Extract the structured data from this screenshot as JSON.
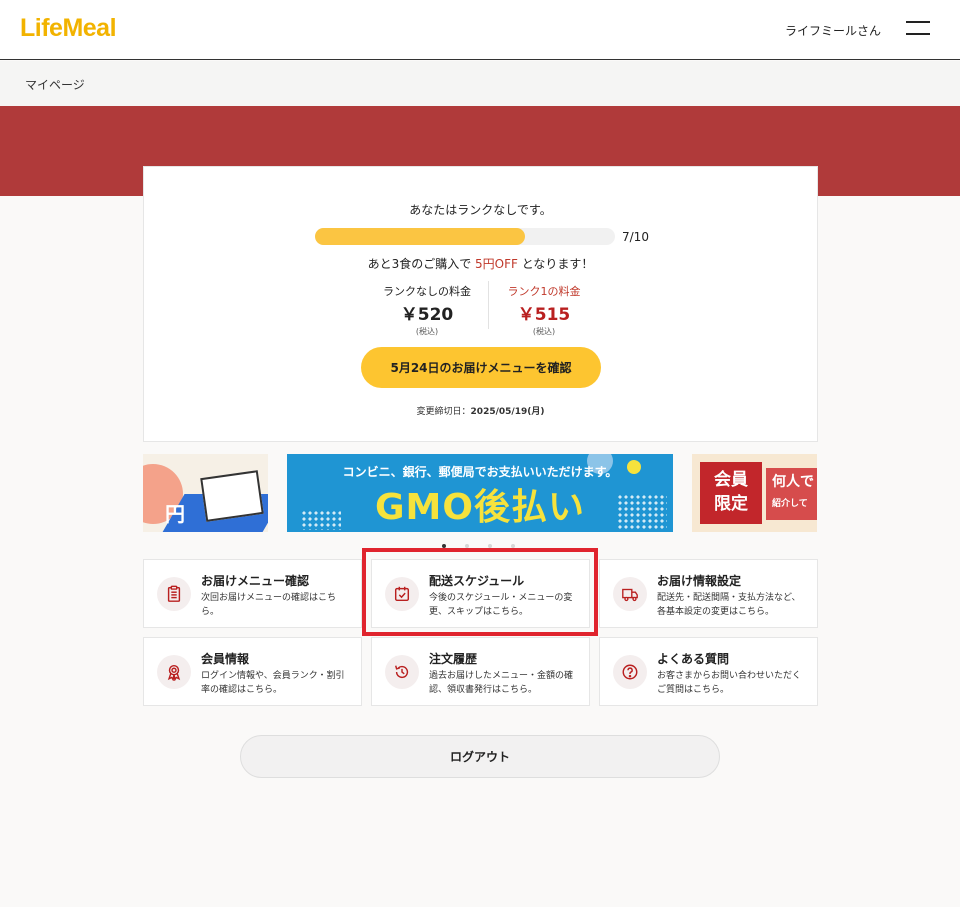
{
  "header": {
    "logo": "LifeMeal",
    "user_name": "ライフミールさん",
    "menu_icon": "hamburger-menu-icon"
  },
  "breadcrumb": {
    "current": "マイページ"
  },
  "colors": {
    "brand_yellow": "#f2b300",
    "accent_red": "#b03a3a",
    "button_yellow": "#fdc530",
    "progress_fill": "#fbc542",
    "highlight_red": "#e0242e"
  },
  "rank": {
    "status": "あなたはランクなしです。",
    "progress_current": 7,
    "progress_total": 10,
    "progress_label": "7/10",
    "message_prefix": "あと3食のご購入で",
    "message_discount": "5円OFF",
    "message_suffix": "となります！",
    "current_price_label": "ランクなしの料金",
    "current_price": "￥520",
    "next_price_label": "ランク1の料金",
    "next_price": "￥515",
    "tax_note": "(税込)",
    "confirm_button": "5月24日のお届けメニューを確認",
    "deadline_label": "変更締切日：",
    "deadline_date": "2025/05/19(月)"
  },
  "banners": {
    "main_caption": "コンビニ、銀行、郵便局でお支払いいただけます。",
    "main_title": "GMO後払い",
    "left_yen": "円",
    "right_box": [
      "会員",
      "限定"
    ],
    "right_side": [
      "何人で",
      "紹介して"
    ],
    "pager_count": 4,
    "pager_active": 0
  },
  "menu": [
    {
      "title": "お届けメニュー確認",
      "desc": "次回お届けメニューの確認はこちら。",
      "icon": "clipboard-list-icon"
    },
    {
      "title": "配送スケジュール",
      "desc": "今後のスケジュール・メニューの変更、スキップはこちら。",
      "icon": "calendar-check-icon"
    },
    {
      "title": "お届け情報設定",
      "desc": "配送先・配送間隔・支払方法など、各基本設定の変更はこちら。",
      "icon": "delivery-truck-icon"
    },
    {
      "title": "会員情報",
      "desc": "ログイン情報や、会員ランク・割引率の確認はこちら。",
      "icon": "award-ribbon-icon"
    },
    {
      "title": "注文履歴",
      "desc": "過去お届けしたメニュー・金額の確認、領収書発行はこちら。",
      "icon": "history-clock-icon"
    },
    {
      "title": "よくある質問",
      "desc": "お客さまからお問い合わせいただくご質問はこちら。",
      "icon": "question-circle-icon"
    }
  ],
  "logout_button": "ログアウト"
}
